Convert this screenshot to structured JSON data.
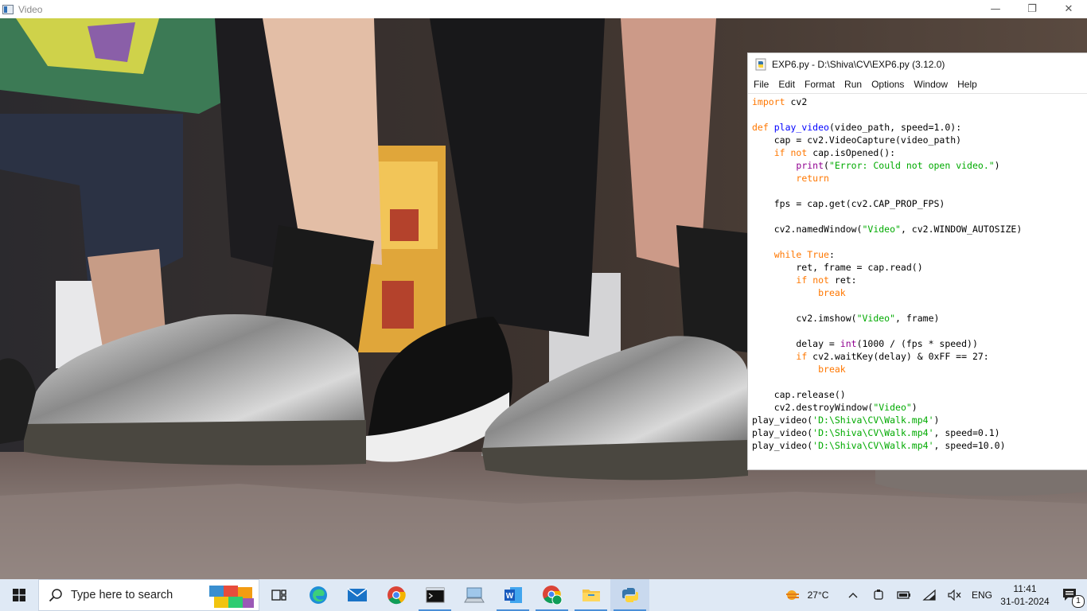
{
  "video_window": {
    "title": "Video",
    "controls": {
      "minimize": "—",
      "maximize": "❐",
      "close": "✕"
    }
  },
  "idle": {
    "title": "EXP6.py - D:\\Shiva\\CV\\EXP6.py (3.12.0)",
    "menu": [
      "File",
      "Edit",
      "Format",
      "Run",
      "Options",
      "Window",
      "Help"
    ],
    "code_lines": [
      [
        {
          "t": "import",
          "c": "kw"
        },
        {
          "t": " cv2"
        }
      ],
      [],
      [
        {
          "t": "def",
          "c": "kw"
        },
        {
          "t": " "
        },
        {
          "t": "play_video",
          "c": "fn"
        },
        {
          "t": "(video_path, speed=1.0):"
        }
      ],
      [
        {
          "t": "    cap = cv2.VideoCapture(video_path)"
        }
      ],
      [
        {
          "t": "    "
        },
        {
          "t": "if",
          "c": "kw"
        },
        {
          "t": " "
        },
        {
          "t": "not",
          "c": "kw"
        },
        {
          "t": " cap.isOpened():"
        }
      ],
      [
        {
          "t": "        "
        },
        {
          "t": "print",
          "c": "bi"
        },
        {
          "t": "("
        },
        {
          "t": "\"Error: Could not open video.\"",
          "c": "st"
        },
        {
          "t": ")"
        }
      ],
      [
        {
          "t": "        "
        },
        {
          "t": "return",
          "c": "kw"
        }
      ],
      [],
      [
        {
          "t": "    fps = cap.get(cv2.CAP_PROP_FPS)"
        }
      ],
      [],
      [
        {
          "t": "    cv2.namedWindow("
        },
        {
          "t": "\"Video\"",
          "c": "st"
        },
        {
          "t": ", cv2.WINDOW_AUTOSIZE)"
        }
      ],
      [],
      [
        {
          "t": "    "
        },
        {
          "t": "while",
          "c": "kw"
        },
        {
          "t": " "
        },
        {
          "t": "True",
          "c": "kw"
        },
        {
          "t": ":"
        }
      ],
      [
        {
          "t": "        ret, frame = cap.read()"
        }
      ],
      [
        {
          "t": "        "
        },
        {
          "t": "if",
          "c": "kw"
        },
        {
          "t": " "
        },
        {
          "t": "not",
          "c": "kw"
        },
        {
          "t": " ret:"
        }
      ],
      [
        {
          "t": "            "
        },
        {
          "t": "break",
          "c": "kw"
        }
      ],
      [],
      [
        {
          "t": "        cv2.imshow("
        },
        {
          "t": "\"Video\"",
          "c": "st"
        },
        {
          "t": ", frame)"
        }
      ],
      [],
      [
        {
          "t": "        delay = "
        },
        {
          "t": "int",
          "c": "bi"
        },
        {
          "t": "(1000 / (fps * speed))"
        }
      ],
      [
        {
          "t": "        "
        },
        {
          "t": "if",
          "c": "kw"
        },
        {
          "t": " cv2.waitKey(delay) & 0xFF == 27:"
        }
      ],
      [
        {
          "t": "            "
        },
        {
          "t": "break",
          "c": "kw"
        }
      ],
      [],
      [
        {
          "t": "    cap.release()"
        }
      ],
      [
        {
          "t": "    cv2.destroyWindow("
        },
        {
          "t": "\"Video\"",
          "c": "st"
        },
        {
          "t": ")"
        }
      ],
      [
        {
          "t": "play_video("
        },
        {
          "t": "'D:\\Shiva\\CV\\Walk.mp4'",
          "c": "st"
        },
        {
          "t": ")"
        }
      ],
      [
        {
          "t": "play_video("
        },
        {
          "t": "'D:\\Shiva\\CV\\Walk.mp4'",
          "c": "st"
        },
        {
          "t": ", speed=0.1)"
        }
      ],
      [
        {
          "t": "play_video("
        },
        {
          "t": "'D:\\Shiva\\CV\\Walk.mp4'",
          "c": "st"
        },
        {
          "t": ", speed=10.0)"
        }
      ]
    ]
  },
  "taskbar": {
    "search_placeholder": "Type here to search",
    "apps": [
      {
        "name": "task-view",
        "icon": "task-view-icon"
      },
      {
        "name": "edge",
        "icon": "edge-icon"
      },
      {
        "name": "mail",
        "icon": "mail-icon"
      },
      {
        "name": "chrome",
        "icon": "chrome-icon"
      },
      {
        "name": "terminal",
        "icon": "terminal-icon"
      },
      {
        "name": "computer",
        "icon": "computer-icon"
      },
      {
        "name": "word",
        "icon": "word-icon"
      },
      {
        "name": "chrome-profile",
        "icon": "chrome-profile-icon"
      },
      {
        "name": "file-explorer",
        "icon": "folder-icon"
      },
      {
        "name": "python",
        "icon": "python-icon"
      }
    ],
    "weather": "27°C",
    "language": "ENG",
    "time": "11:41",
    "date": "31-01-2024",
    "notification_count": "1"
  },
  "colors": {
    "keyword": "#ff7700",
    "builtin": "#900090",
    "function": "#0000ff",
    "string": "#00aa00",
    "taskbar": "#dfe9f5"
  }
}
